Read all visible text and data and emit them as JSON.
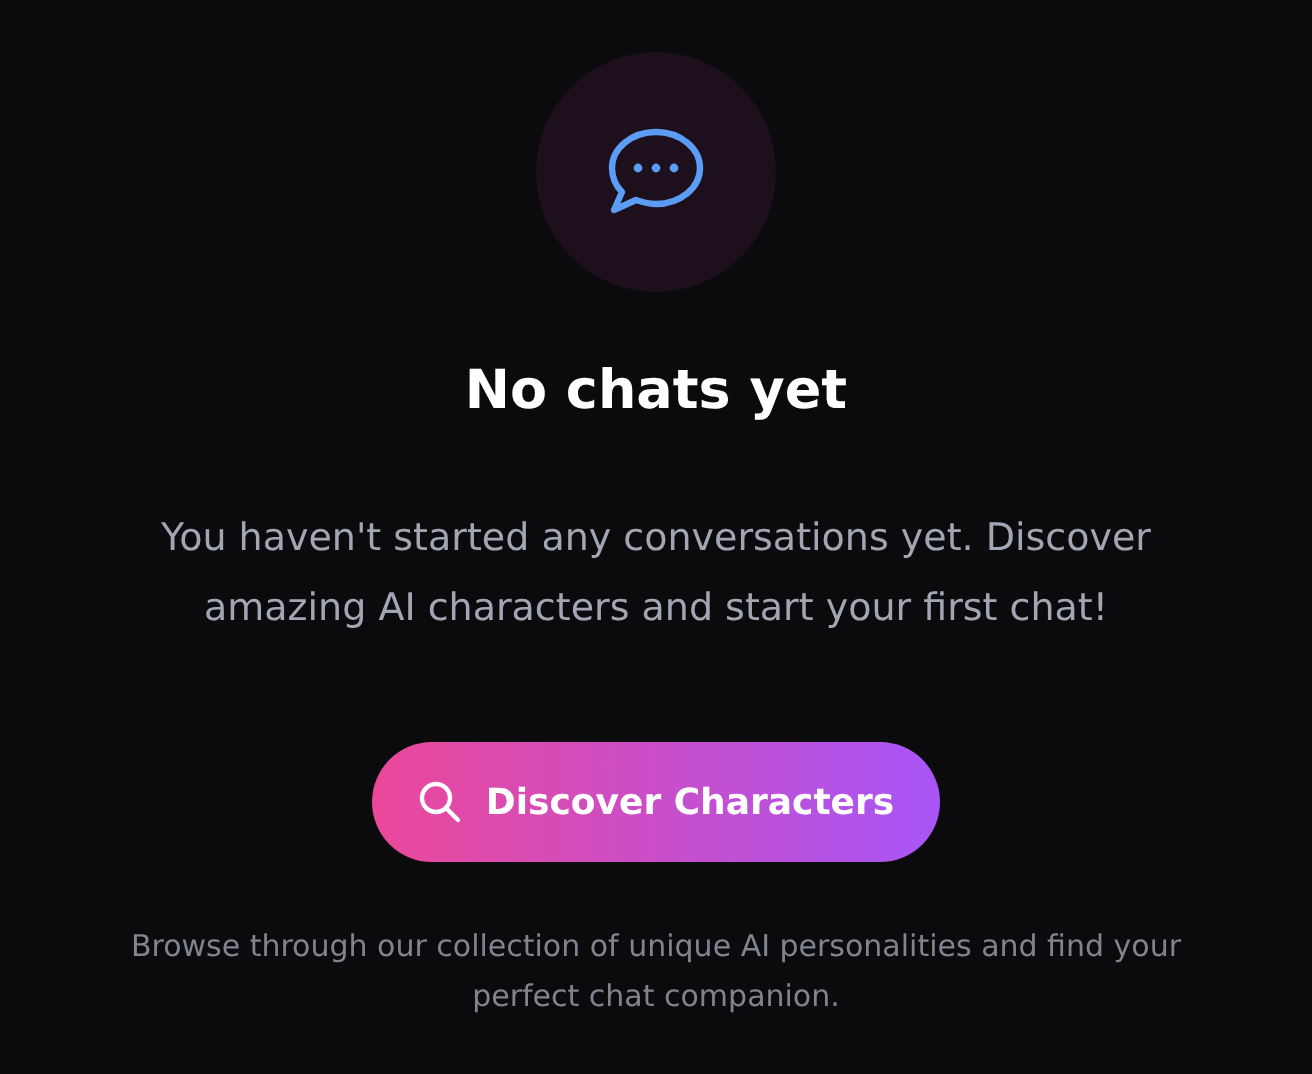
{
  "empty_state": {
    "title": "No chats yet",
    "message": "You haven't started any conversations yet. Discover amazing AI characters and start your first chat!",
    "button": {
      "label": "Discover Characters"
    },
    "hint": "Browse through our collection of unique AI personalities and find your perfect chat companion."
  }
}
